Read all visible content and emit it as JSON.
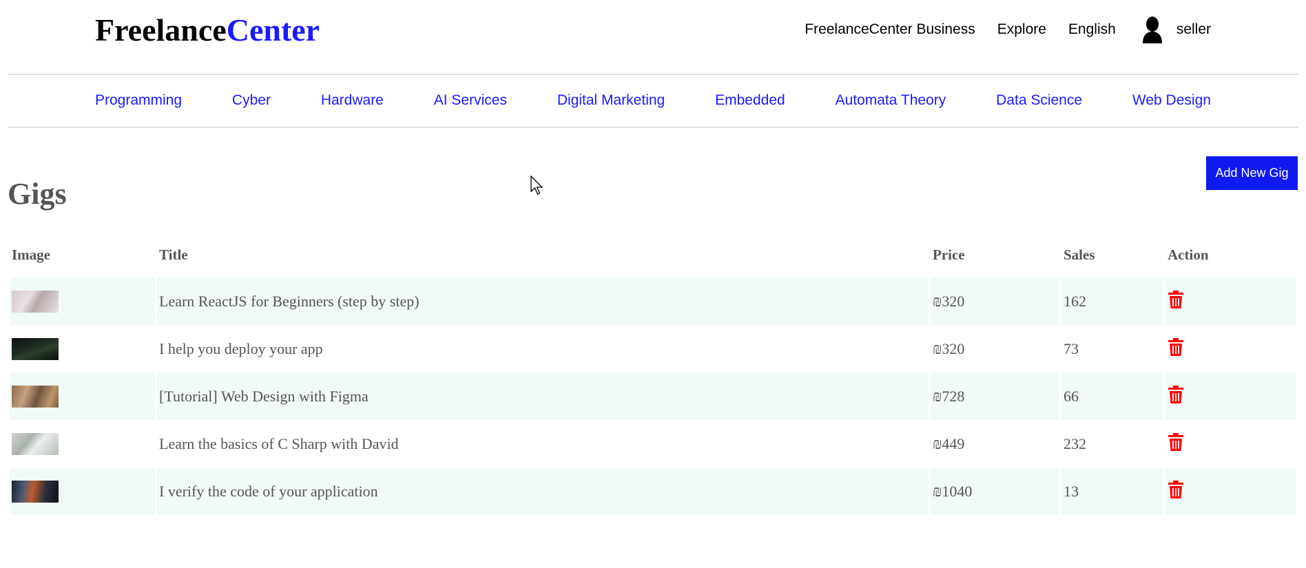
{
  "header": {
    "logo_part1": "Freelance",
    "logo_part2": "Center",
    "links": [
      "FreelanceCenter Business",
      "Explore",
      "English"
    ],
    "user_name": "seller"
  },
  "categories": [
    "Programming",
    "Cyber",
    "Hardware",
    "AI Services",
    "Digital Marketing",
    "Embedded",
    "Automata Theory",
    "Data Science",
    "Web Design"
  ],
  "page": {
    "title": "Gigs",
    "add_button_label": "Add New Gig"
  },
  "table": {
    "columns": [
      "Image",
      "Title",
      "Price",
      "Sales",
      "Action"
    ],
    "rows": [
      {
        "title": "Learn ReactJS for Beginners (step by step)",
        "price": "₪320",
        "sales": "162"
      },
      {
        "title": "I help you deploy your app",
        "price": "₪320",
        "sales": "73"
      },
      {
        "title": "[Tutorial] Web Design with Figma",
        "price": "₪728",
        "sales": "66"
      },
      {
        "title": "Learn the basics of C Sharp with David",
        "price": "₪449",
        "sales": "232"
      },
      {
        "title": "I verify the code of your application",
        "price": "₪1040",
        "sales": "13"
      }
    ]
  },
  "icons": {
    "user": "user-silhouette-icon",
    "delete": "trash-icon",
    "cursor": "mouse-pointer-icon"
  },
  "colors": {
    "brand_blue": "#1a1aff",
    "button_blue": "#0f1aef",
    "delete_red": "#ff0000",
    "row_stripe": "#f1faf6",
    "heading_gray": "#555555"
  }
}
